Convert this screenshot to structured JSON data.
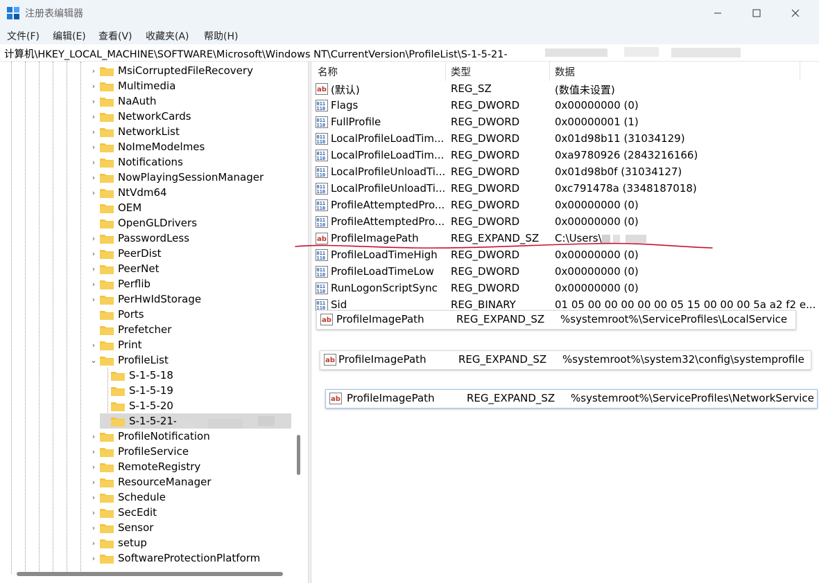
{
  "window": {
    "title": "注册表编辑器",
    "controls": {
      "minimize": "—",
      "maximize": "☐",
      "close": "✕"
    }
  },
  "menu": [
    "文件(F)",
    "编辑(E)",
    "查看(V)",
    "收藏夹(A)",
    "帮助(H)"
  ],
  "address": "计算机\\HKEY_LOCAL_MACHINE\\SOFTWARE\\Microsoft\\Windows NT\\CurrentVersion\\ProfileList\\S-1-5-21-",
  "tree": {
    "items": [
      {
        "label": "MsiCorruptedFileRecovery",
        "chev": "›"
      },
      {
        "label": "Multimedia",
        "chev": "›"
      },
      {
        "label": "NaAuth",
        "chev": "›"
      },
      {
        "label": "NetworkCards",
        "chev": "›"
      },
      {
        "label": "NetworkList",
        "chev": "›"
      },
      {
        "label": "NoImeModelmes",
        "chev": "›"
      },
      {
        "label": "Notifications",
        "chev": "›"
      },
      {
        "label": "NowPlayingSessionManager",
        "chev": "›"
      },
      {
        "label": "NtVdm64",
        "chev": "›"
      },
      {
        "label": "OEM",
        "chev": ""
      },
      {
        "label": "OpenGLDrivers",
        "chev": ""
      },
      {
        "label": "PasswordLess",
        "chev": "›"
      },
      {
        "label": "PeerDist",
        "chev": "›"
      },
      {
        "label": "PeerNet",
        "chev": "›"
      },
      {
        "label": "Perflib",
        "chev": "›"
      },
      {
        "label": "PerHwIdStorage",
        "chev": "›"
      },
      {
        "label": "Ports",
        "chev": ""
      },
      {
        "label": "Prefetcher",
        "chev": ""
      },
      {
        "label": "Print",
        "chev": "›"
      },
      {
        "label": "ProfileList",
        "chev": "⌄"
      },
      {
        "label": "S-1-5-18",
        "chev": ""
      },
      {
        "label": "S-1-5-19",
        "chev": ""
      },
      {
        "label": "S-1-5-20",
        "chev": ""
      },
      {
        "label": "S-1-5-21-",
        "chev": ""
      },
      {
        "label": "ProfileNotification",
        "chev": "›"
      },
      {
        "label": "ProfileService",
        "chev": "›"
      },
      {
        "label": "RemoteRegistry",
        "chev": "›"
      },
      {
        "label": "ResourceManager",
        "chev": "›"
      },
      {
        "label": "Schedule",
        "chev": "›"
      },
      {
        "label": "SecEdit",
        "chev": "›"
      },
      {
        "label": "Sensor",
        "chev": "›"
      },
      {
        "label": "setup",
        "chev": "›"
      },
      {
        "label": "SoftwareProtectionPlatform",
        "chev": "›"
      }
    ]
  },
  "list": {
    "headers": {
      "name": "名称",
      "type": "类型",
      "data": "数据"
    },
    "rows": [
      {
        "icon": "string-value-icon",
        "name": "(默认)",
        "type": "REG_SZ",
        "data": "(数值未设置)"
      },
      {
        "icon": "binary-value-icon",
        "name": "Flags",
        "type": "REG_DWORD",
        "data": "0x00000000 (0)"
      },
      {
        "icon": "binary-value-icon",
        "name": "FullProfile",
        "type": "REG_DWORD",
        "data": "0x00000001 (1)"
      },
      {
        "icon": "binary-value-icon",
        "name": "LocalProfileLoadTim...",
        "type": "REG_DWORD",
        "data": "0x01d98b11 (31034129)"
      },
      {
        "icon": "binary-value-icon",
        "name": "LocalProfileLoadTim...",
        "type": "REG_DWORD",
        "data": "0xa9780926 (2843216166)"
      },
      {
        "icon": "binary-value-icon",
        "name": "LocalProfileUnloadTi...",
        "type": "REG_DWORD",
        "data": "0x01d98b0f (31034127)"
      },
      {
        "icon": "binary-value-icon",
        "name": "LocalProfileUnloadTi...",
        "type": "REG_DWORD",
        "data": "0xc791478a (3348187018)"
      },
      {
        "icon": "binary-value-icon",
        "name": "ProfileAttemptedPro...",
        "type": "REG_DWORD",
        "data": "0x00000000 (0)"
      },
      {
        "icon": "binary-value-icon",
        "name": "ProfileAttemptedPro...",
        "type": "REG_DWORD",
        "data": "0x00000000 (0)"
      },
      {
        "icon": "string-value-icon",
        "name": "ProfileImagePath",
        "type": "REG_EXPAND_SZ",
        "data": "C:\\Users\\"
      },
      {
        "icon": "binary-value-icon",
        "name": "ProfileLoadTimeHigh",
        "type": "REG_DWORD",
        "data": "0x00000000 (0)"
      },
      {
        "icon": "binary-value-icon",
        "name": "ProfileLoadTimeLow",
        "type": "REG_DWORD",
        "data": "0x00000000 (0)"
      },
      {
        "icon": "binary-value-icon",
        "name": "RunLogonScriptSync",
        "type": "REG_DWORD",
        "data": "0x00000000 (0)"
      },
      {
        "icon": "binary-value-icon",
        "name": "Sid",
        "type": "REG_BINARY",
        "data": "01 05 00 00 00 00 00 05 15 00 00 00 5a a2 f2 e..."
      }
    ]
  },
  "overlays": [
    {
      "name": "ProfileImagePath",
      "type": "REG_EXPAND_SZ",
      "data": "%systemroot%\\ServiceProfiles\\LocalService"
    },
    {
      "name": "ProfileImagePath",
      "type": "REG_EXPAND_SZ",
      "data": "%systemroot%\\system32\\config\\systemprofile"
    },
    {
      "name": "ProfileImagePath",
      "type": "REG_EXPAND_SZ",
      "data": "%systemroot%\\ServiceProfiles\\NetworkService"
    }
  ],
  "colors": {
    "folder": "#f4c542",
    "selection": "#d9d9d9",
    "annotation": "#c8102e",
    "icon_blue": "#2a5fb0",
    "icon_red": "#c0392b"
  }
}
